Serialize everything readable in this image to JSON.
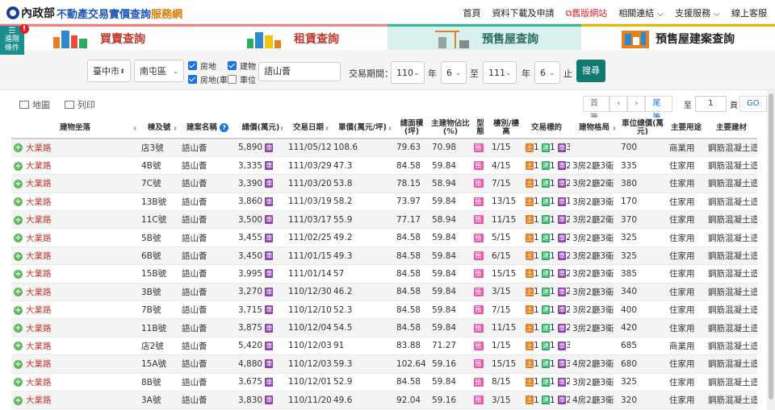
{
  "header": {
    "ministry": "內政部",
    "service": "不動產交易實價查詢",
    "suffix": "服務網",
    "nav": [
      {
        "label": "首頁"
      },
      {
        "label": "資料下載及申請"
      },
      {
        "label": "舊版網站"
      },
      {
        "label": "相關連結 ⌵"
      },
      {
        "label": "支援服務 ⌵"
      },
      {
        "label": "線上客服"
      }
    ]
  },
  "advanced": {
    "label_line1": "進階",
    "label_line2": "條件",
    "badge": "!"
  },
  "tabs": [
    {
      "label": "買賣查詢"
    },
    {
      "label": "租賃查詢"
    },
    {
      "label": "預售屋查詢"
    },
    {
      "label": "預售屋建案查詢"
    }
  ],
  "filters": {
    "city": "臺中市",
    "district": "南屯區",
    "checks": {
      "house": "房地",
      "building": "建物",
      "house_parking": "房地(車)",
      "parking": "車位"
    },
    "keyword": "語山薈",
    "period_label": "交易期間：",
    "from_year": "110",
    "from_month": "6",
    "to_year": "111",
    "to_month": "6",
    "year_unit": "年",
    "to_word": "至",
    "end_word": "止",
    "search": "搜尋"
  },
  "toolbar": {
    "map": "地圖",
    "print": "列印",
    "first": "首筆",
    "prev": "‹",
    "next": "›",
    "last": "尾筆",
    "to": "至",
    "page": "1",
    "page_unit": "頁",
    "go": "GO"
  },
  "columns": [
    "建物坐落",
    "棟及號",
    "建案名稱",
    "總價(萬元)",
    "交易日期",
    "單價(萬元/坪)",
    "總面積(坪)",
    "主建物佔比(%)",
    "型態",
    "樓別/樓高",
    "交易標的",
    "建物格局",
    "車位總價(萬元)",
    "主要用途",
    "主要建材"
  ],
  "rows": [
    {
      "loc": "大業路",
      "unit": "店3號",
      "proj": "語山薈",
      "price": "5,890",
      "car": true,
      "date": "111/05/12",
      "uprice": "108.6",
      "area": "79.63",
      "ratio": "70.98",
      "floor": "1/15",
      "t": [
        "1",
        "1",
        "3"
      ],
      "layout": "",
      "park": "700",
      "use": "商業用",
      "mat": "鋼筋混凝土造"
    },
    {
      "loc": "大業路",
      "unit": "4B號",
      "proj": "語山薈",
      "price": "3,335",
      "car": true,
      "date": "111/03/29",
      "uprice": "47.3",
      "area": "84.58",
      "ratio": "59.84",
      "floor": "4/15",
      "t": [
        "1",
        "1",
        "2"
      ],
      "layout": "3房2廳3衛",
      "park": "335",
      "use": "住家用",
      "mat": "鋼筋混凝土造"
    },
    {
      "loc": "大業路",
      "unit": "7C號",
      "proj": "語山薈",
      "price": "3,390",
      "car": true,
      "date": "111/03/20",
      "uprice": "53.8",
      "area": "78.15",
      "ratio": "58.94",
      "floor": "7/15",
      "t": [
        "1",
        "1",
        "2"
      ],
      "layout": "3房2廳2衛",
      "park": "380",
      "use": "住家用",
      "mat": "鋼筋混凝土造"
    },
    {
      "loc": "大業路",
      "unit": "13B號",
      "proj": "語山薈",
      "price": "3,860",
      "car": true,
      "date": "111/03/19",
      "uprice": "58.2",
      "area": "73.97",
      "ratio": "59.84",
      "floor": "13/15",
      "t": [
        "1",
        "1",
        "1"
      ],
      "layout": "3房2廳3衛",
      "park": "170",
      "use": "住家用",
      "mat": "鋼筋混凝土造"
    },
    {
      "loc": "大業路",
      "unit": "11C號",
      "proj": "語山薈",
      "price": "3,500",
      "car": true,
      "date": "111/03/17",
      "uprice": "55.9",
      "area": "77.17",
      "ratio": "58.94",
      "floor": "11/15",
      "t": [
        "1",
        "1",
        "2"
      ],
      "layout": "3房2廳2衛",
      "park": "370",
      "use": "住家用",
      "mat": "鋼筋混凝土造"
    },
    {
      "loc": "大業路",
      "unit": "5B號",
      "proj": "語山薈",
      "price": "3,455",
      "car": true,
      "date": "111/02/25",
      "uprice": "49.2",
      "area": "84.58",
      "ratio": "59.84",
      "floor": "5/15",
      "t": [
        "1",
        "1",
        "2"
      ],
      "layout": "3房2廳3衛",
      "park": "325",
      "use": "住家用",
      "mat": "鋼筋混凝土造"
    },
    {
      "loc": "大業路",
      "unit": "6B號",
      "proj": "語山薈",
      "price": "3,450",
      "car": true,
      "date": "111/01/15",
      "uprice": "49.3",
      "area": "84.58",
      "ratio": "59.84",
      "floor": "6/15",
      "t": [
        "1",
        "1",
        "2"
      ],
      "layout": "3房2廳3衛",
      "park": "325",
      "use": "住家用",
      "mat": "鋼筋混凝土造"
    },
    {
      "loc": "大業路",
      "unit": "15B號",
      "proj": "語山薈",
      "price": "3,995",
      "car": true,
      "date": "111/01/14",
      "uprice": "57",
      "area": "84.58",
      "ratio": "59.84",
      "floor": "15/15",
      "t": [
        "1",
        "1",
        "2"
      ],
      "layout": "3房2廳3衛",
      "park": "385",
      "use": "住家用",
      "mat": "鋼筋混凝土造"
    },
    {
      "loc": "大業路",
      "unit": "3B號",
      "proj": "語山薈",
      "price": "3,270",
      "car": true,
      "date": "110/12/30",
      "uprice": "46.2",
      "area": "84.58",
      "ratio": "59.84",
      "floor": "3/15",
      "t": [
        "1",
        "1",
        "2"
      ],
      "layout": "3房2廳3衛",
      "park": "340",
      "use": "住家用",
      "mat": "鋼筋混凝土造"
    },
    {
      "loc": "大業路",
      "unit": "7B號",
      "proj": "語山薈",
      "price": "3,715",
      "car": true,
      "date": "110/12/10",
      "uprice": "52.3",
      "area": "84.58",
      "ratio": "59.84",
      "floor": "7/15",
      "t": [
        "1",
        "1",
        "2"
      ],
      "layout": "3房2廳3衛",
      "park": "400",
      "use": "住家用",
      "mat": "鋼筋混凝土造"
    },
    {
      "loc": "大業路",
      "unit": "11B號",
      "proj": "語山薈",
      "price": "3,875",
      "car": true,
      "date": "110/12/04",
      "uprice": "54.5",
      "area": "84.58",
      "ratio": "59.84",
      "floor": "11/15",
      "t": [
        "1",
        "1",
        "2"
      ],
      "layout": "3房2廳3衛",
      "park": "420",
      "use": "住家用",
      "mat": "鋼筋混凝土造"
    },
    {
      "loc": "大業路",
      "unit": "店2號",
      "proj": "語山薈",
      "price": "5,420",
      "car": true,
      "date": "110/12/03",
      "uprice": "91",
      "area": "83.88",
      "ratio": "71.27",
      "floor": "1/15",
      "t": [
        "1",
        "1",
        "3"
      ],
      "layout": "",
      "park": "685",
      "use": "商業用",
      "mat": "鋼筋混凝土造"
    },
    {
      "loc": "大業路",
      "unit": "15A號",
      "proj": "語山薈",
      "price": "4,880",
      "car": true,
      "date": "110/12/03",
      "uprice": "59.3",
      "area": "102.64",
      "ratio": "59.16",
      "floor": "15/15",
      "t": [
        "1",
        "1",
        "3"
      ],
      "layout": "4房2廳3衛",
      "park": "680",
      "use": "住家用",
      "mat": "鋼筋混凝土造"
    },
    {
      "loc": "大業路",
      "unit": "8B號",
      "proj": "語山薈",
      "price": "3,675",
      "car": true,
      "date": "110/12/01",
      "uprice": "52.9",
      "area": "84.58",
      "ratio": "59.84",
      "floor": "8/15",
      "t": [
        "1",
        "1",
        "2"
      ],
      "layout": "3房2廳3衛",
      "park": "325",
      "use": "住家用",
      "mat": "鋼筋混凝土造"
    },
    {
      "loc": "大業路",
      "unit": "3A號",
      "proj": "語山薈",
      "price": "3,830",
      "car": true,
      "date": "110/11/20",
      "uprice": "49.6",
      "area": "92.04",
      "ratio": "59.16",
      "floor": "3/15",
      "t": [
        "1",
        "1",
        "2"
      ],
      "layout": "4房2廳3衛",
      "park": "320",
      "use": "住家用",
      "mat": "鋼筋混凝土造"
    }
  ],
  "tags": {
    "car": "車",
    "type": "預",
    "land": "土",
    "bld": "建",
    "park": "車"
  }
}
